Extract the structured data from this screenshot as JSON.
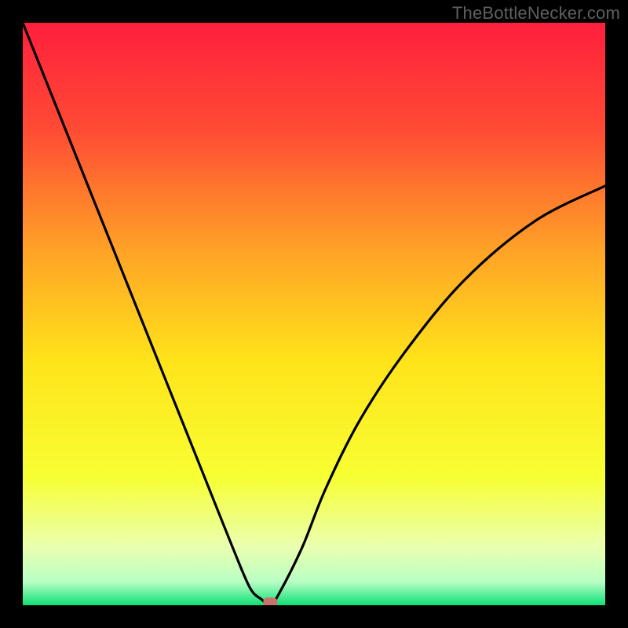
{
  "watermark": {
    "text": "TheBottleNecker.com"
  },
  "chart_data": {
    "type": "line",
    "title": "",
    "xlabel": "",
    "ylabel": "",
    "xlim": [
      0,
      100
    ],
    "ylim": [
      0,
      100
    ],
    "background": {
      "stops": [
        {
          "offset": 0,
          "color": "#ff1f3d"
        },
        {
          "offset": 0.18,
          "color": "#ff4a34"
        },
        {
          "offset": 0.4,
          "color": "#ffa626"
        },
        {
          "offset": 0.58,
          "color": "#ffe31a"
        },
        {
          "offset": 0.78,
          "color": "#f7ff33"
        },
        {
          "offset": 0.9,
          "color": "#eaffb0"
        },
        {
          "offset": 0.96,
          "color": "#b8ffc4"
        },
        {
          "offset": 1.0,
          "color": "#0ee077"
        }
      ]
    },
    "series": [
      {
        "name": "bottleneck-curve",
        "color": "#000000",
        "x": [
          0,
          4,
          8,
          12,
          16,
          20,
          24,
          28,
          32,
          36,
          39,
          41,
          42.5,
          44,
          48,
          52,
          58,
          66,
          76,
          88,
          100
        ],
        "y": [
          100,
          90,
          80,
          70,
          60,
          50,
          40,
          30,
          20,
          10,
          3,
          1,
          0,
          2,
          10,
          20,
          32,
          44,
          56,
          66,
          72
        ]
      }
    ],
    "marker": {
      "name": "result-marker",
      "x": 42.5,
      "y": 0.5,
      "color": "#c9736c"
    }
  }
}
